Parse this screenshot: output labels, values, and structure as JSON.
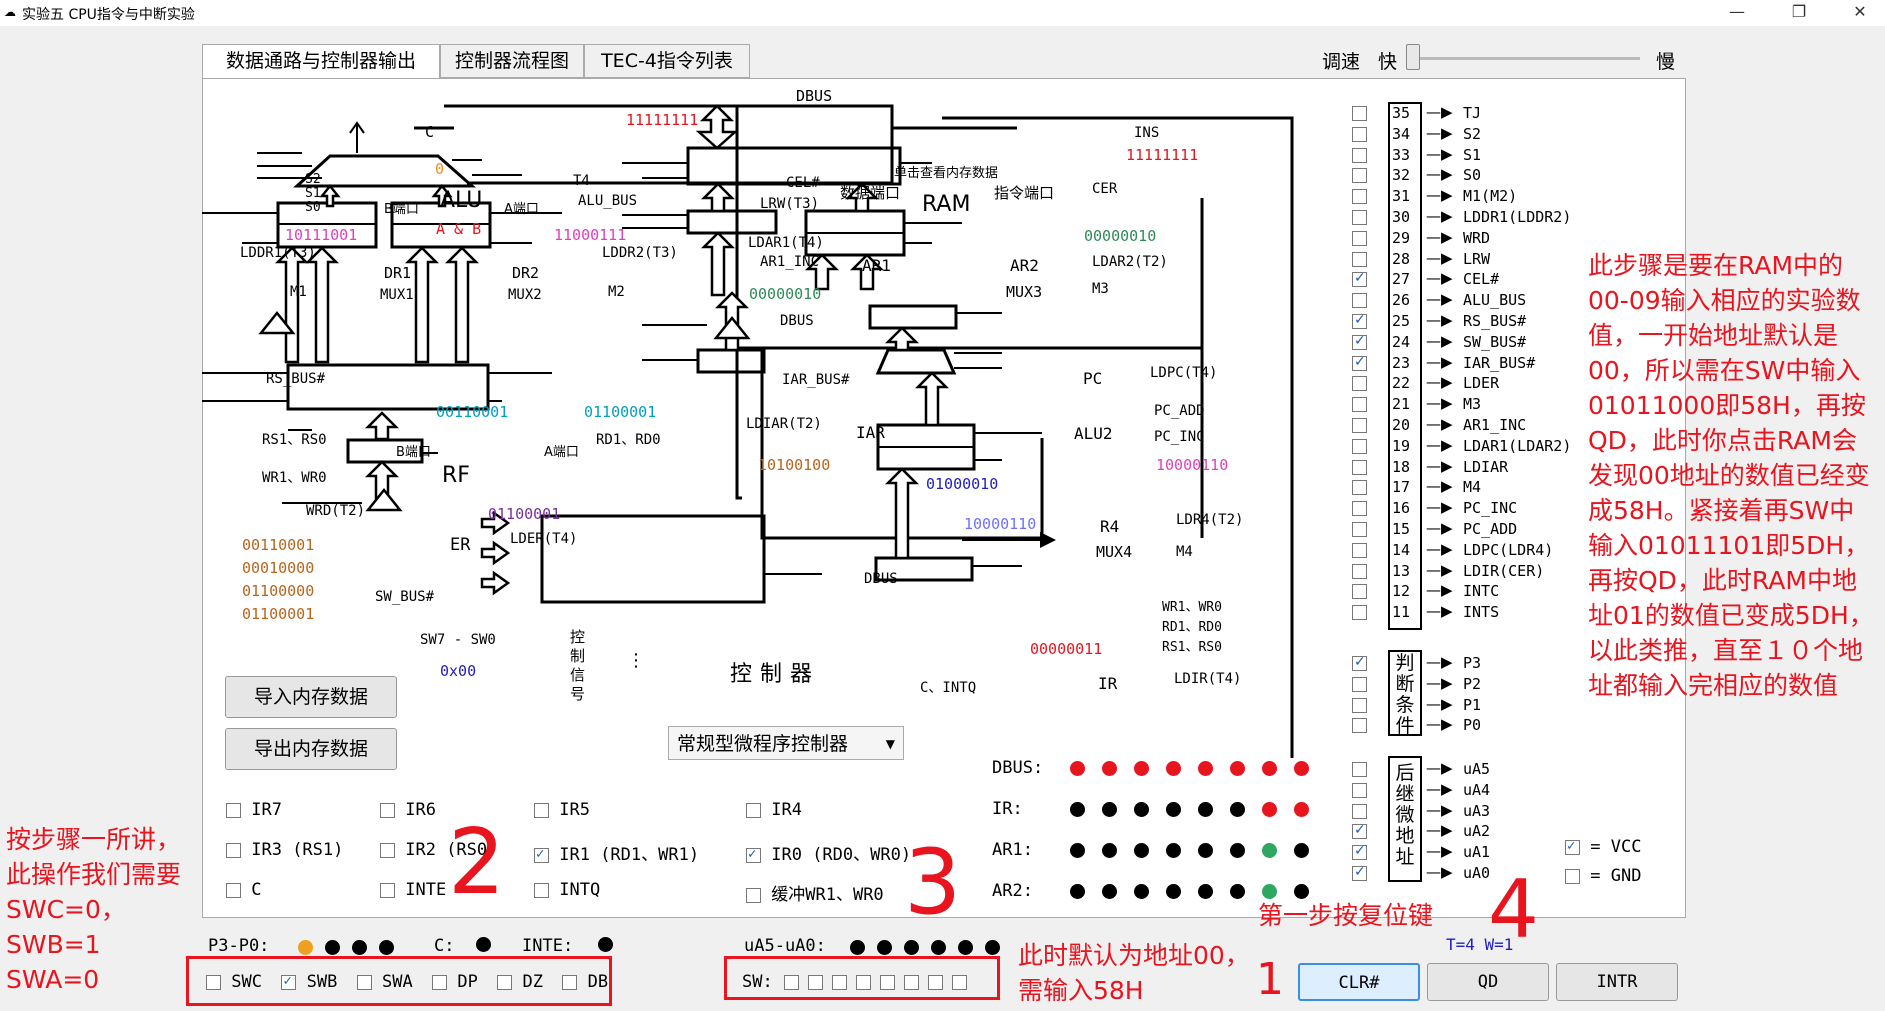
{
  "window": {
    "title": "实验五 CPU指令与中断实验"
  },
  "tabs": [
    "数据通路与控制器输出",
    "控制器流程图",
    "TEC-4指令列表"
  ],
  "speed": {
    "label": "调速",
    "fast": "快",
    "slow": "慢"
  },
  "diagram": {
    "dbus_top": "DBUS",
    "dbus_top_value": "11111111",
    "c_label": "C",
    "c_value": "0",
    "alu": "ALU",
    "alu_b_port": "B端口",
    "alu_a_port": "A端口",
    "alu_op": "A & B",
    "s2": "S2",
    "s1": "S1",
    "s0": "S0",
    "t4": "T4",
    "alu_bus": "ALU_BUS",
    "dr1_value": "10111001",
    "dr2_value": "11000111",
    "lddr1": "LDDR1(T3)",
    "lddr2": "LDDR2(T3)",
    "dr1": "DR1",
    "dr2": "DR2",
    "mux1": "MUX1",
    "mux2": "MUX2",
    "m1": "M1",
    "m2": "M2",
    "rs_bus": "RS_BUS#",
    "rf_b_value": "00110001",
    "rf_a_value": "01100001",
    "rs": "RS1、RS0",
    "rd": "RD1、RD0",
    "wr": "WR1、WR0",
    "rf": "RF",
    "rf_b_port": "B端口",
    "rf_a_port": "A端口",
    "wrd": "WRD(T2)",
    "er_value": "01100001",
    "er": "ER",
    "lder": "LDER(T4)",
    "regs": [
      "00110001",
      "00010000",
      "01100000",
      "01100001"
    ],
    "sw_bus": "SW_BUS#",
    "sw_range": "SW7 - SW0",
    "sw_hex": "0x00",
    "cel": "CEL#",
    "lrw": "LRW(T3)",
    "ram_hint": "单击查看内存数据",
    "ram": "RAM",
    "ram_data_port": "数据端口",
    "ram_ins_port": "指令端口",
    "cer": "CER",
    "ins": "INS",
    "ins_value": "11111111",
    "ldar1": "LDAR1(T4)",
    "ar1_inc": "AR1_INC",
    "ar1": "AR1",
    "ar1_value": "00000010",
    "ar2": "AR2",
    "mux3": "MUX3",
    "ar2_value": "00000010",
    "ldar2": "LDAR2(T2)",
    "m3": "M3",
    "dbus_mid": "DBUS",
    "iar_bus": "IAR_BUS#",
    "ldiar": "LDIAR(T2)",
    "iar": "IAR",
    "iar_value": "10100100",
    "pc": "PC",
    "ldpc": "LDPC(T4)",
    "alu2": "ALU2",
    "pc_add": "PC_ADD",
    "pc_inc": "PC_INC",
    "pc_value": "10000110",
    "bus_value": "01000010",
    "r4_value": "10000110",
    "r4": "R4",
    "mux4": "MUX4",
    "ldr4": "LDR4(T2)",
    "m4": "M4",
    "dbus_low": "DBUS",
    "ir_signals": [
      "WR1、WR0",
      "RD1、RD0",
      "RS1、RS0"
    ],
    "ctrl_signals": "控制信号",
    "controller": "控制器",
    "ir_value": "00000011",
    "ir": "IR",
    "ldir": "LDIR(T4)",
    "c_intq": "C、INTQ",
    "ctrl_type": "常规型微程序控制器"
  },
  "buttons": {
    "import": "导入内存数据",
    "export": "导出内存数据",
    "clr": "CLR#",
    "qd": "QD",
    "intr": "INTR"
  },
  "flags": {
    "row1": [
      "IR7",
      "IR6",
      "IR5",
      "IR4"
    ],
    "row2": [
      "IR3 (RS1)",
      "IR2 (RS0)",
      "IR1 (RD1、WR1)",
      "IR0 (RD0、WR0)"
    ],
    "row3": [
      "C",
      "INTE",
      "INTQ",
      "缓冲WR1、WR0"
    ]
  },
  "buses": {
    "dbus": "DBUS:",
    "ir": "IR:",
    "ar1": "AR1:",
    "ar2": "AR2:"
  },
  "bottom": {
    "p": "P3-P0:",
    "c": "C:",
    "inte": "INTE:",
    "ua": "uA5-uA0:",
    "sw": "SW:",
    "switches": [
      "SWC",
      "SWB",
      "SWA",
      "DP",
      "DZ",
      "DB"
    ],
    "t": "T=4  W=1"
  },
  "signals": [
    "TJ",
    "S2",
    "S1",
    "S0",
    "M1(M2)",
    "LDDR1(LDDR2)",
    "WRD",
    "LRW",
    "CEL#",
    "ALU_BUS",
    "RS_BUS#",
    "SW_BUS#",
    "IAR_BUS#",
    "LDER",
    "M3",
    "AR1_INC",
    "LDAR1(LDAR2)",
    "LDIAR",
    "M4",
    "PC_INC",
    "PC_ADD",
    "LDPC(LDR4)",
    "LDIR(CER)",
    "INTC",
    "INTS"
  ],
  "signal_nums": [
    "35",
    "34",
    "33",
    "32",
    "31",
    "30",
    "29",
    "28",
    "27",
    "26",
    "25",
    "24",
    "23",
    "22",
    "21",
    "20",
    "19",
    "18",
    "17",
    "16",
    "15",
    "14",
    "13",
    "12",
    "11"
  ],
  "judge_label": "判断条件",
  "judge": [
    "P3",
    "P2",
    "P1",
    "P0"
  ],
  "next_label": "后继微地址",
  "next": [
    "uA5",
    "uA4",
    "uA3",
    "uA2",
    "uA1",
    "uA0"
  ],
  "vcc": "= VCC",
  "gnd": "= GND",
  "annotations": {
    "right": "此步骤是要在RAM中的00-09输入相应的实验数值，一开始地址默认是00，所以需在SW中输入01011000即58H，再按QD，此时你点击RAM会发现00地址的数值已经变成58H。紧接着再SW中输入01011101即5DH，再按QD，此时RAM中地址01的数值已变成5DH，以此类推，直至１０个地址都输入完相应的数值",
    "left": "按步骤一所讲，此操作我们需要SWC=0，SWB=1 SWA=0",
    "addr": "此时默认为地址00，需输入58H",
    "reset": "第一步按复位键",
    "n2": "2",
    "n3": "3",
    "n4": "4",
    "n1": "1"
  },
  "colors": {
    "red": "#e8141e",
    "pink": "#e040c0",
    "green": "#2e8b57",
    "blue": "#2020c0",
    "brown": "#b8651e",
    "purple": "#7b2fa0"
  }
}
